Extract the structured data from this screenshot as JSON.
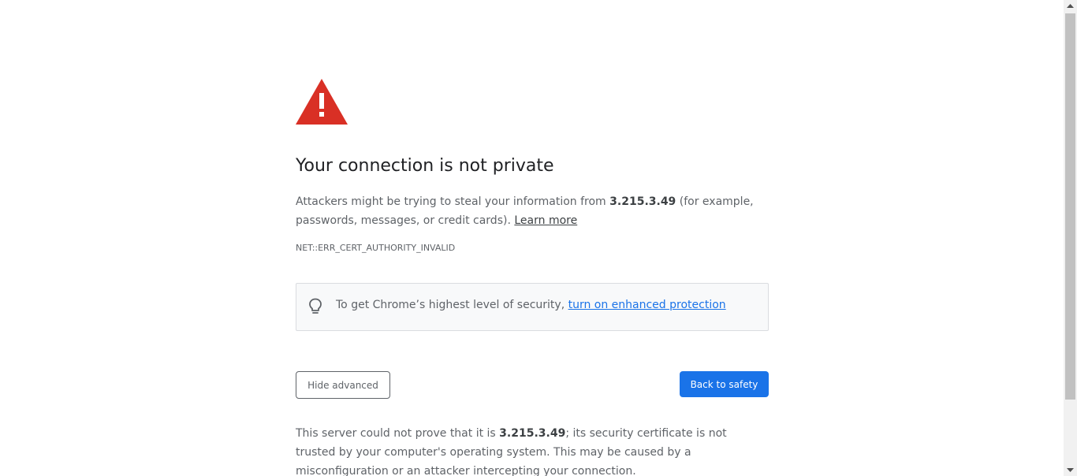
{
  "interstitial": {
    "title": "Your connection is not private",
    "desc_prefix": "Attackers might be trying to steal your information from ",
    "host": "3.215.3.49",
    "desc_suffix": " (for example, passwords, messages, or credit cards). ",
    "learn_more": "Learn more",
    "error_code": "NET::ERR_CERT_AUTHORITY_INVALID"
  },
  "promo": {
    "icon": "lightbulb-icon",
    "text": "To get Chrome’s highest level of security, ",
    "link": "turn on enhanced protection"
  },
  "buttons": {
    "hide_advanced": "Hide advanced",
    "back_to_safety": "Back to safety"
  },
  "details": {
    "prefix": "This server could not prove that it is ",
    "host": "3.215.3.49",
    "suffix": "; its security certificate is not trusted by your computer's operating system. This may be caused by a misconfiguration or an attacker intercepting your connection."
  },
  "colors": {
    "warning_red": "#d93025",
    "primary_blue": "#1a73e8",
    "link_blue": "#1a73e8",
    "body_text": "#5f6368",
    "title_text": "#202124"
  }
}
